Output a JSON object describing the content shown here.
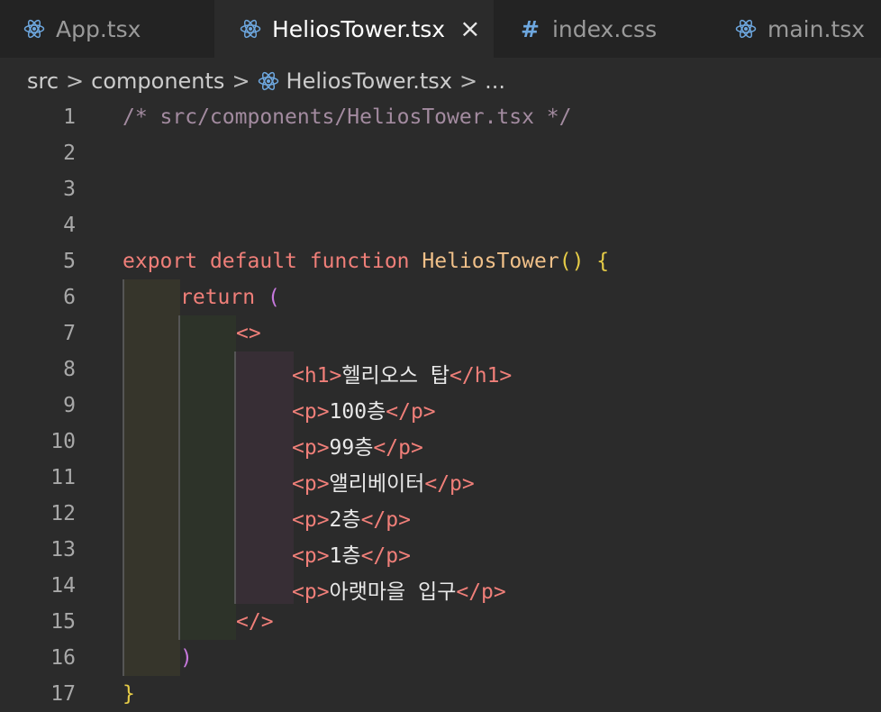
{
  "tabs": [
    {
      "label": "App.tsx",
      "icon": "react-icon",
      "active": false
    },
    {
      "label": "HeliosTower.tsx",
      "icon": "react-icon",
      "active": true
    },
    {
      "label": "index.css",
      "icon": "hash-icon",
      "active": false
    },
    {
      "label": "main.tsx",
      "icon": "react-icon",
      "active": false
    }
  ],
  "tab_close": "×",
  "breadcrumb": {
    "part1": "src",
    "part2": "components",
    "part3": "HeliosTower.tsx",
    "part4": "...",
    "separator": ">"
  },
  "line_numbers": [
    "1",
    "2",
    "3",
    "4",
    "5",
    "6",
    "7",
    "8",
    "9",
    "10",
    "11",
    "12",
    "13",
    "14",
    "15",
    "16",
    "17"
  ],
  "code": {
    "l1": "/* src/components/HeliosTower.tsx */",
    "l5_export": "export",
    "l5_default": "default",
    "l5_function": "function",
    "l5_name": "HeliosTower",
    "l5_parens": "()",
    "l5_brace": "{",
    "l6_return": "return",
    "l6_paren": "(",
    "l7": "<>",
    "l8_open": "<h1>",
    "l8_text": "헬리오스 탑",
    "l8_close": "</h1>",
    "l9_open": "<p>",
    "l9_text": "100층",
    "l9_close": "</p>",
    "l10_open": "<p>",
    "l10_text": "99층",
    "l10_close": "</p>",
    "l11_open": "<p>",
    "l11_text": "앨리베이터",
    "l11_close": "</p>",
    "l12_open": "<p>",
    "l12_text": "2층",
    "l12_close": "</p>",
    "l13_open": "<p>",
    "l13_text": "1층",
    "l13_close": "</p>",
    "l14_open": "<p>",
    "l14_text": "아랫마을 입구",
    "l14_close": "</p>",
    "l15": "</>",
    "l16": ")",
    "l17": "}"
  },
  "colors": {
    "background": "#2b2b2b",
    "tabbar": "#232323",
    "comment": "#a38ba0",
    "keyword": "#f07f79",
    "function_name": "#f0c089",
    "bracket": "#e6cc47",
    "tag": "#f07f79",
    "react_icon": "#6ea8e0",
    "indent_1": "#36352b",
    "indent_2": "#2d3329",
    "indent_3": "#372e35"
  }
}
